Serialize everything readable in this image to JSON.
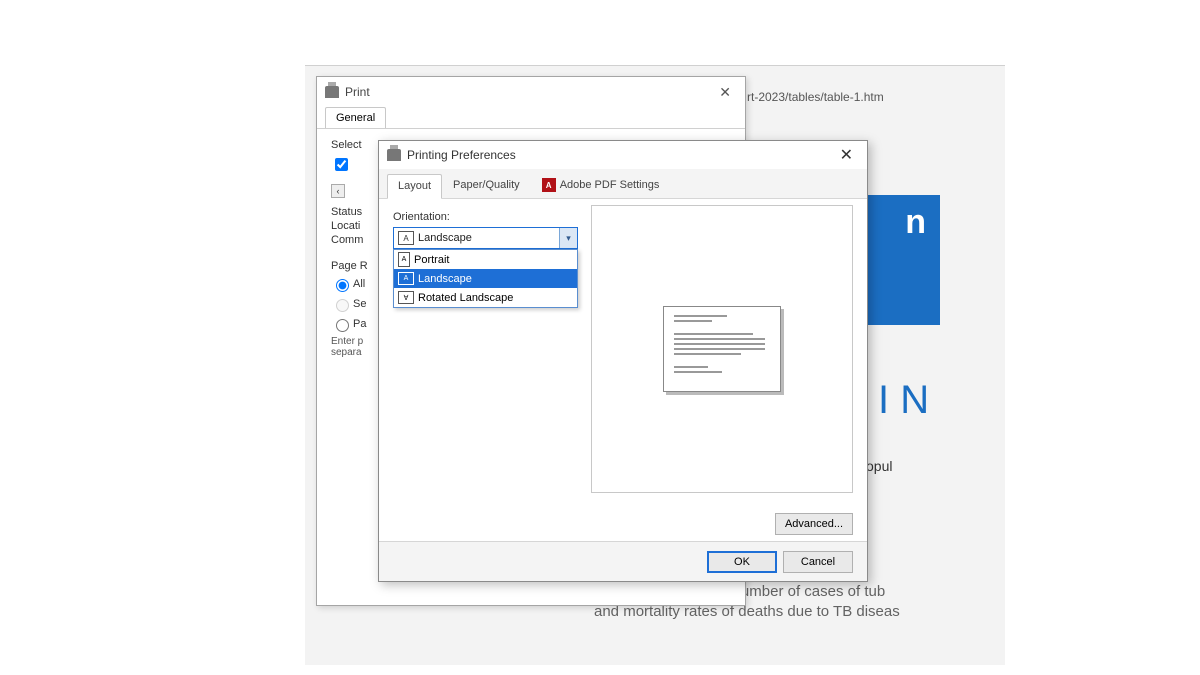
{
  "background": {
    "url_fragment": "rt-2023/tables/table-1.htm",
    "banner_text": "n",
    "big_glyph": "I N",
    "text_frag": "opul",
    "body_line1": "This table describes the number of cases of tub",
    "body_line2": "and mortality rates of deaths due to TB diseas"
  },
  "print_dialog": {
    "title": "Print",
    "tabs": [
      "General"
    ],
    "select": "Select",
    "status": "Status",
    "location": "Locati",
    "comment": "Comm",
    "page_range": "Page R",
    "all": "All",
    "sel": "Se",
    "pages": "Pa",
    "hint1": "Enter p",
    "hint2": "separa"
  },
  "pref_dialog": {
    "title": "Printing Preferences",
    "tabs": {
      "layout": "Layout",
      "paper": "Paper/Quality",
      "pdf": "Adobe PDF Settings"
    },
    "orientation_label": "Orientation:",
    "orientation_value": "Landscape",
    "orientation_options": {
      "portrait": "Portrait",
      "landscape": "Landscape",
      "rotated": "Rotated Landscape"
    },
    "advanced": "Advanced...",
    "ok": "OK",
    "cancel": "Cancel"
  }
}
